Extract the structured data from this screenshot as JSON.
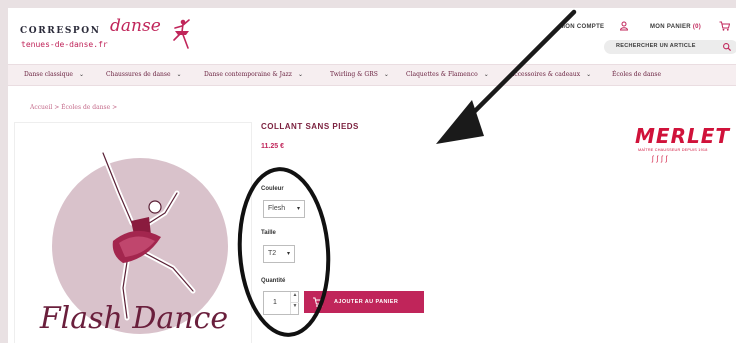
{
  "header": {
    "logo": {
      "main": "CORRESPON",
      "script": "danse",
      "sub": "tenues-de-danse.fr"
    },
    "account_label": "MON COMPTE",
    "cart_label": "MON PANIER",
    "cart_count": "(0)",
    "search_placeholder": "RECHERCHER UN ARTICLE"
  },
  "nav": {
    "items": [
      {
        "label": "Danse classique"
      },
      {
        "label": "Chaussures de danse"
      },
      {
        "label": "Danse contemporaine & Jazz"
      },
      {
        "label": "Twirling & GRS"
      },
      {
        "label": "Claquettes & Flamenco"
      },
      {
        "label": "Accessoires & cadeaux"
      },
      {
        "label": "Écoles de danse"
      }
    ],
    "chevron": "⌄"
  },
  "breadcrumb": "Accueil >   Écoles de danse >",
  "product": {
    "title": "COLLANT SANS PIEDS",
    "price": "11.25 €",
    "image_text": "Flash Dance",
    "couleur_label": "Couleur",
    "couleur_value": "Flesh",
    "taille_label": "Taille",
    "taille_value": "T2",
    "quantite_label": "Quantité",
    "quantity": "1",
    "add_to_cart": "AJOUTER AU PANIER"
  },
  "brand": {
    "name": "MERLET",
    "tagline": "MAÎTRE CHAUSSEUR DEPUIS 1918"
  },
  "colors": {
    "accent": "#c0255a",
    "title": "#7a1f3d",
    "merlet_red": "#d0123a",
    "image_circle": "#d9c2cb"
  },
  "icons": [
    "account-icon",
    "cart-icon",
    "search-icon",
    "chevron-down-icon",
    "cart-add-icon"
  ]
}
